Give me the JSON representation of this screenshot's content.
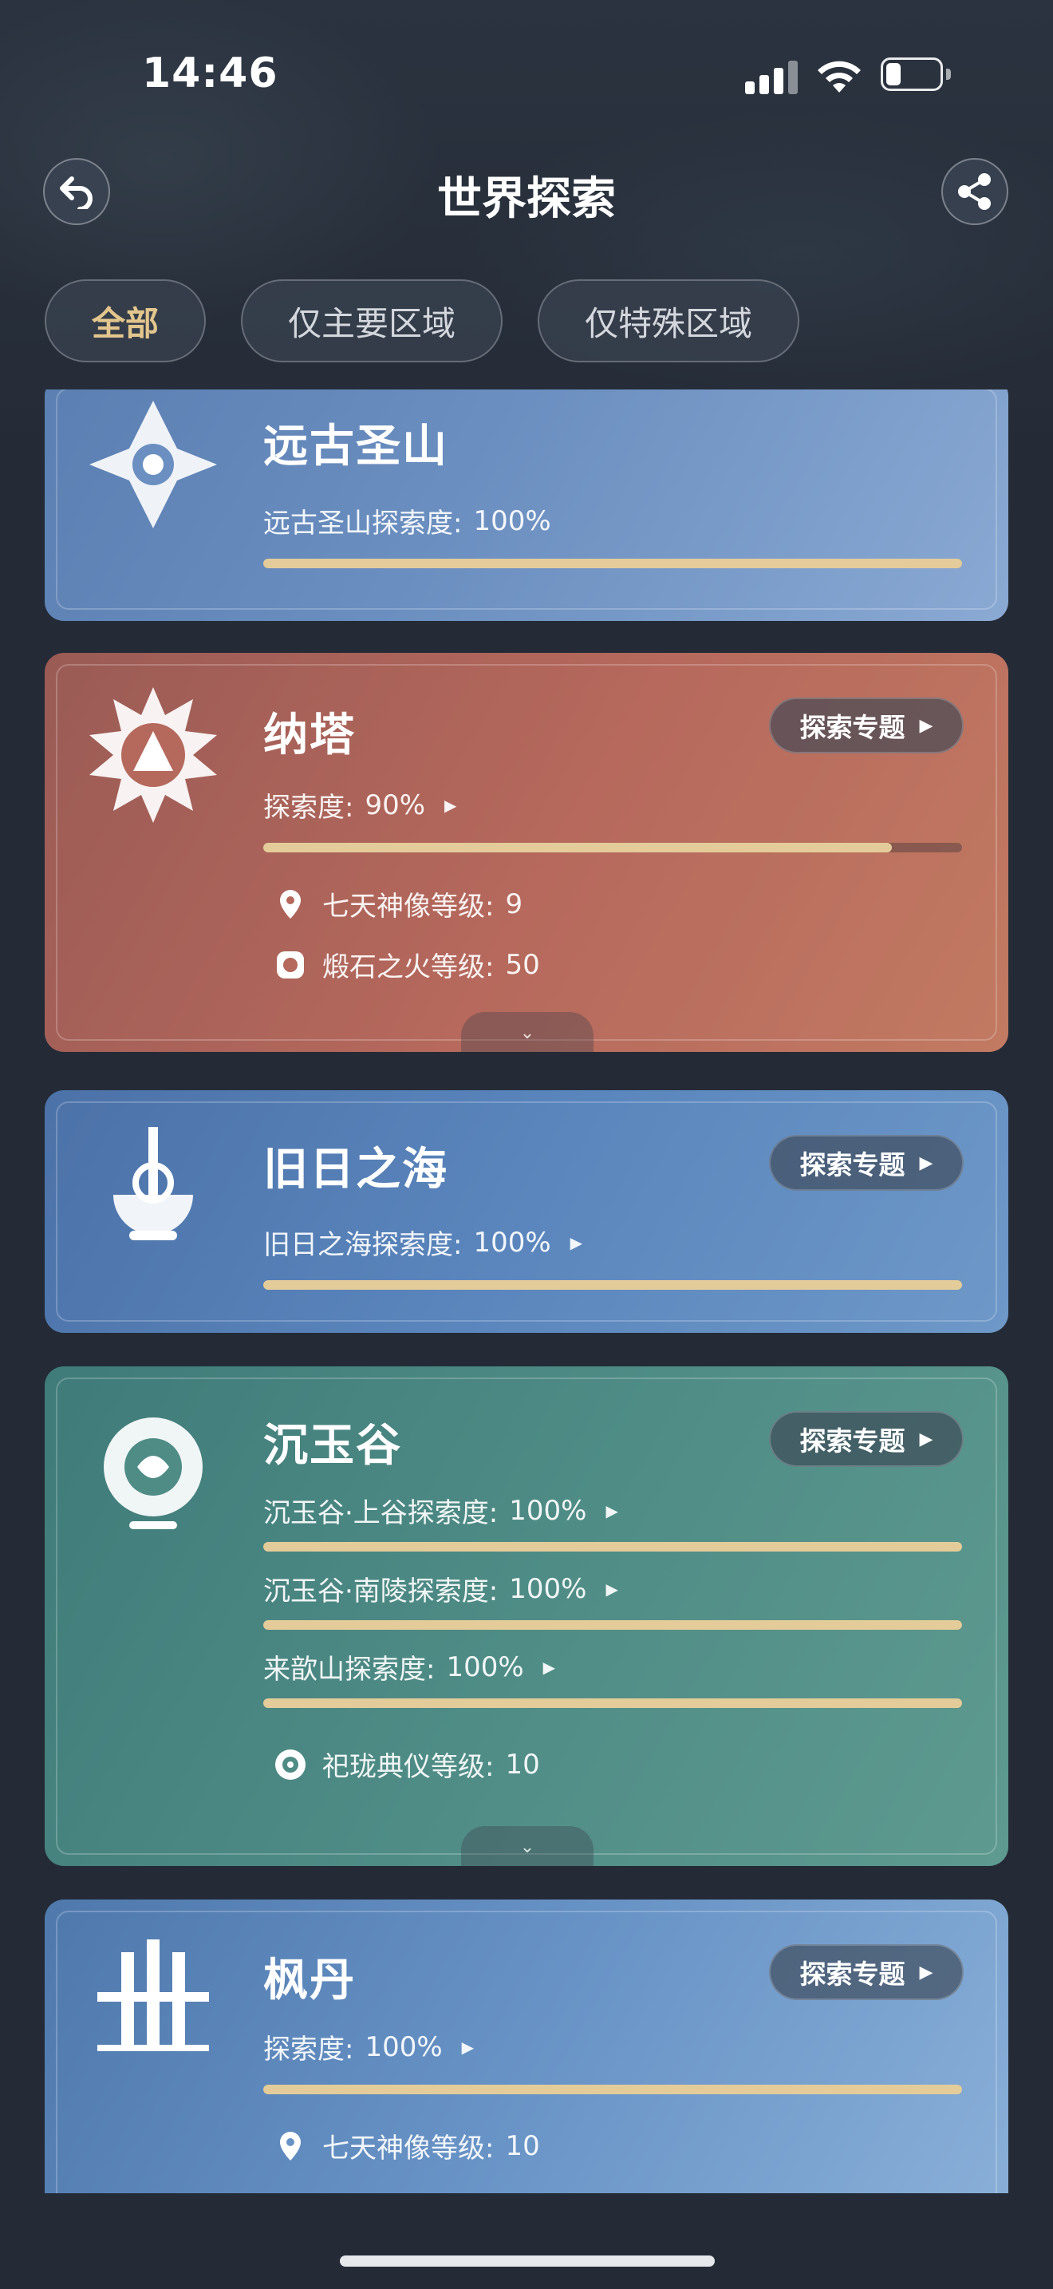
{
  "status": {
    "time": "14:46"
  },
  "header": {
    "title": "世界探索"
  },
  "filters": [
    {
      "label": "全部",
      "active": true
    },
    {
      "label": "仅主要区域",
      "active": false
    },
    {
      "label": "仅特殊区域",
      "active": false
    }
  ],
  "colors": {
    "accent_gold": "#e3c68d",
    "progress_fill": "#e3cc9a",
    "background": "#242b37"
  },
  "icons": [
    "back-arrow-icon",
    "share-icon",
    "signal-icon",
    "wifi-icon",
    "battery-icon",
    "map-pin-icon",
    "forge-fire-icon",
    "lantern-rite-icon",
    "chevron-down-icon"
  ],
  "regions": [
    {
      "name": "远古圣山",
      "rows": [
        {
          "label": "远古圣山探索度:",
          "value": "100%",
          "progress": 1.0
        }
      ]
    },
    {
      "name": "纳塔",
      "topic_button": "探索专题",
      "rows": [
        {
          "label": "探索度:",
          "value": "90%",
          "progress": 0.9
        }
      ],
      "subs": [
        {
          "label": "七天神像等级:",
          "value": "9"
        },
        {
          "label": "煅石之火等级:",
          "value": "50"
        }
      ]
    },
    {
      "name": "旧日之海",
      "topic_button": "探索专题",
      "rows": [
        {
          "label": "旧日之海探索度:",
          "value": "100%",
          "progress": 1.0
        }
      ]
    },
    {
      "name": "沉玉谷",
      "topic_button": "探索专题",
      "rows": [
        {
          "label": "沉玉谷·上谷探索度:",
          "value": "100%",
          "progress": 1.0
        },
        {
          "label": "沉玉谷·南陵探索度:",
          "value": "100%",
          "progress": 1.0
        },
        {
          "label": "来歆山探索度:",
          "value": "100%",
          "progress": 1.0
        }
      ],
      "subs": [
        {
          "label": "祀珑典仪等级:",
          "value": "10"
        }
      ]
    },
    {
      "name": "枫丹",
      "topic_button": "探索专题",
      "rows": [
        {
          "label": "探索度:",
          "value": "100%",
          "progress": 1.0
        }
      ],
      "subs": [
        {
          "label": "七天神像等级:",
          "value": "10"
        }
      ]
    }
  ]
}
